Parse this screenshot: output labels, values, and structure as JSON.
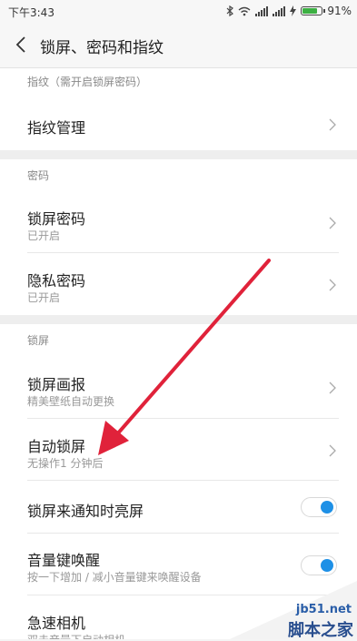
{
  "status": {
    "time": "下午3:43",
    "battery_percent": "91%",
    "battery_level": 0.91
  },
  "header": {
    "back_icon": "back-chevron-icon",
    "title": "锁屏、密码和指纹"
  },
  "sections": {
    "fingerprint": {
      "header": "指纹（需开启锁屏密码）",
      "items": [
        {
          "label": "指纹管理"
        }
      ]
    },
    "password": {
      "header": "密码",
      "items": [
        {
          "label": "锁屏密码",
          "sub": "已开启"
        },
        {
          "label": "隐私密码",
          "sub": "已开启"
        }
      ]
    },
    "lockscreen": {
      "header": "锁屏",
      "items": [
        {
          "label": "锁屏画报",
          "sub": "精美壁纸自动更换"
        },
        {
          "label": "自动锁屏",
          "sub": "无操作1 分钟后"
        },
        {
          "label": "锁屏来通知时亮屏",
          "toggle": true
        },
        {
          "label": "音量键唤醒",
          "sub": "按一下增加 / 减小音量键来唤醒设备",
          "toggle": true
        },
        {
          "label": "急速相机",
          "sub": "双击音量下启动相机"
        }
      ]
    }
  },
  "watermark": {
    "site": "jb51.net",
    "brand": "脚本之家"
  },
  "colors": {
    "toggle_accent": "#1e90e6",
    "annotation_arrow": "#e0223a"
  }
}
